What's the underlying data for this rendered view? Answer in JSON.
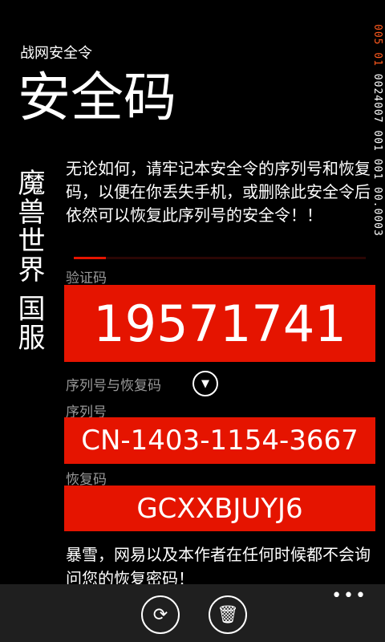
{
  "status_bar": {
    "time_prefix": "005 01",
    "rest": " 0024007 001 001 00.0003",
    "accent": "#ff5a1e"
  },
  "header": {
    "app_name": "战网安全令",
    "title": "安全码"
  },
  "side_label": "魔兽世界 国服",
  "warning": "无论如何，请牢记本安全令的序列号和恢复码，以便在你丢失手机，或删除此安全令后依然可以恢复此序列号的安全令！！",
  "progress": 0.11,
  "code": {
    "label": "验证码",
    "value": "19571741"
  },
  "serial_section": {
    "label": "序列号与恢复码",
    "expand_icon": "chevron-down-circle-icon"
  },
  "serial": {
    "label": "序列号",
    "value": "CN-1403-1154-3667"
  },
  "restore": {
    "label": "恢复码",
    "value": "GCXXBJUYJ6"
  },
  "notice": "暴雪，网易以及本作者在任何时候都不会询问您的恢复密码！",
  "appbar": {
    "refresh_icon": "refresh-icon",
    "delete_icon": "trash-icon",
    "more": "•••"
  },
  "colors": {
    "accent": "#e51400"
  }
}
